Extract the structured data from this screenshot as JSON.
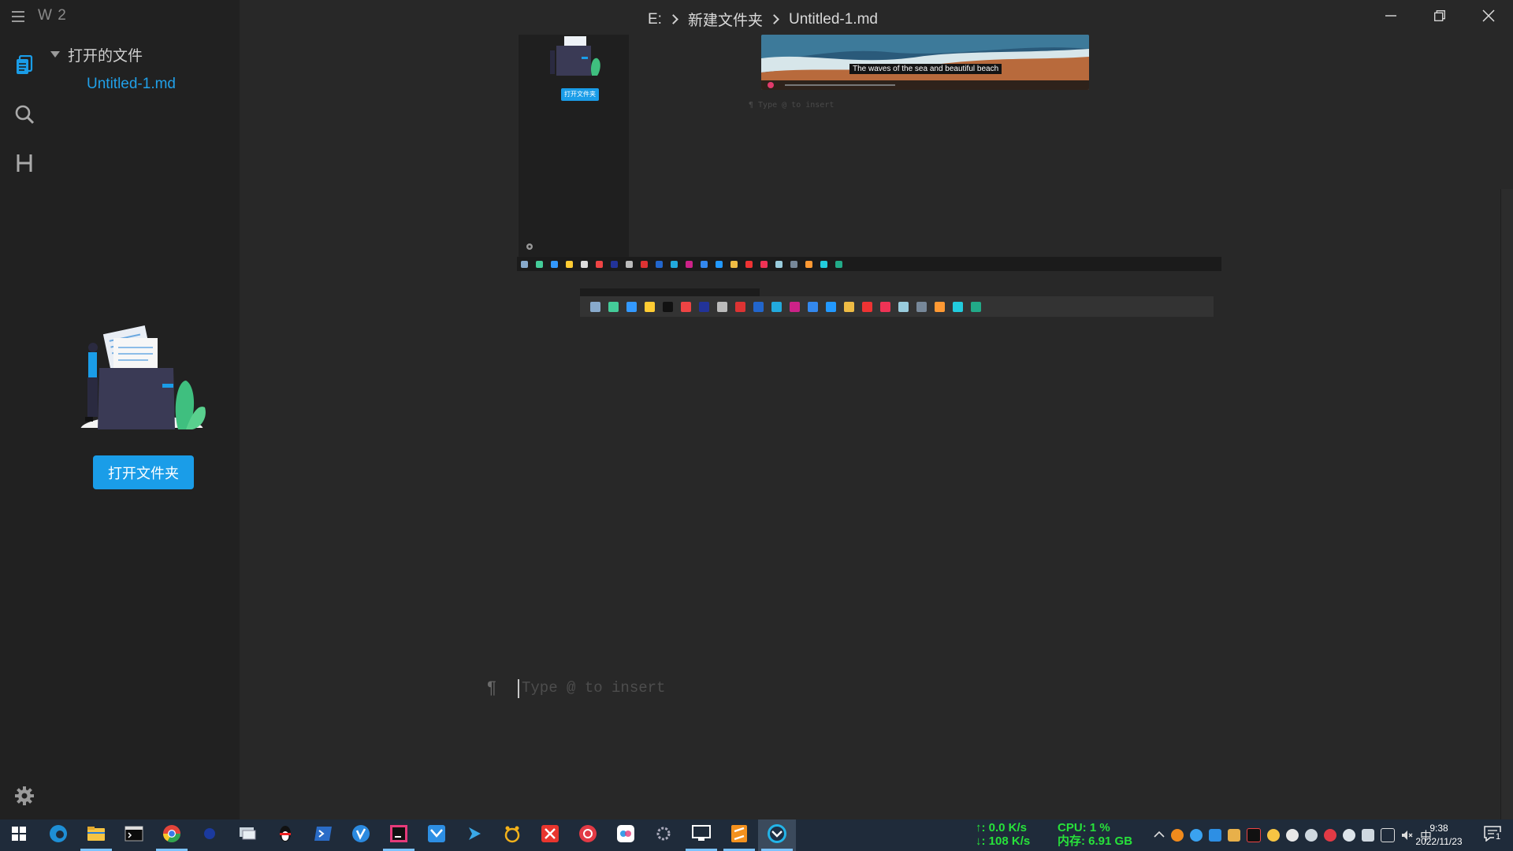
{
  "app": {
    "name": "W 2"
  },
  "sidebar": {
    "tree_header": "打开的文件",
    "open_files": [
      "Untitled-1.md"
    ],
    "open_folder_button": "打开文件夹",
    "activity_icons": [
      "files-icon",
      "search-icon",
      "headings-icon"
    ]
  },
  "titlebar": {
    "breadcrumb": [
      "E:",
      "新建文件夹",
      "Untitled-1.md"
    ]
  },
  "editor": {
    "paragraph_mark": "¶",
    "placeholder": "Type @ to insert",
    "embedded_images": {
      "image1_button": "打开文件夹",
      "image2_caption": "The waves of the sea and beautiful beach",
      "image2_para_placeholder": "¶  Type @ to insert"
    }
  },
  "taskbar": {
    "net_up": "↑: 0.0 K/s",
    "net_down": "↓: 108 K/s",
    "cpu": "CPU: 1 %",
    "memory": "内存: 6.91 GB",
    "ime": "中",
    "time": "9:38",
    "date": "2022/11/23",
    "notification_count": "1",
    "colors": {
      "bg": "#1f2b3a",
      "monitor_text": "#27e23a"
    }
  },
  "colors": {
    "accent": "#1a9de8",
    "editor_bg": "#282828",
    "sidebar_bg": "#212121"
  }
}
